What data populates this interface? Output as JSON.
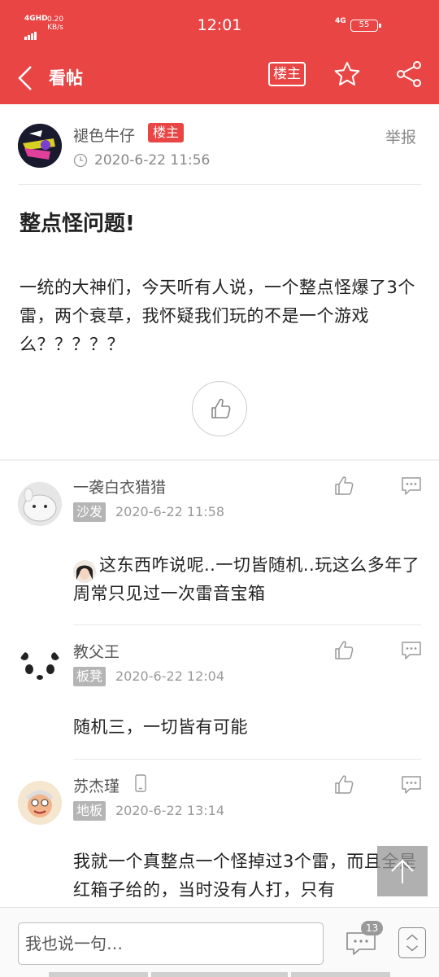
{
  "status_bar": {
    "network": "4GHD",
    "speed": "0.20",
    "speed_unit": "KB/s",
    "time": "12:01",
    "signal": "4G",
    "battery": "55"
  },
  "header": {
    "title": "看帖",
    "owner_button": "楼主"
  },
  "post": {
    "author": "褪色牛仔",
    "author_badge": "楼主",
    "report_label": "举报",
    "time": "2020-6-22 11:56",
    "title": "整点怪问题!",
    "body": "一统的大神们，今天听有人说，一个整点怪爆了3个雷，两个衰草，我怀疑我们玩的不是一个游戏么？？？？？"
  },
  "replies": [
    {
      "name": "一袭白衣猎猎",
      "floor": "沙发",
      "time": "2020-6-22 11:58",
      "content": "这东西咋说呢..一切皆随机..玩这么多年了周常只见过一次雷音宝箱"
    },
    {
      "name": "教父王",
      "floor": "板凳",
      "time": "2020-6-22 12:04",
      "content": "随机三，一切皆有可能"
    },
    {
      "name": "苏杰瑾",
      "floor": "地板",
      "time": "2020-6-22 13:14",
      "content": "我就一个真整点一个怪掉过3个雷，而且全是红箱子给的，当时没有人打，只有"
    }
  ],
  "bottom_bar": {
    "input_placeholder": "我也说一句…",
    "comment_count": "13"
  },
  "colors": {
    "brand": "#e94545",
    "badge_gray": "#b5b5b5"
  }
}
